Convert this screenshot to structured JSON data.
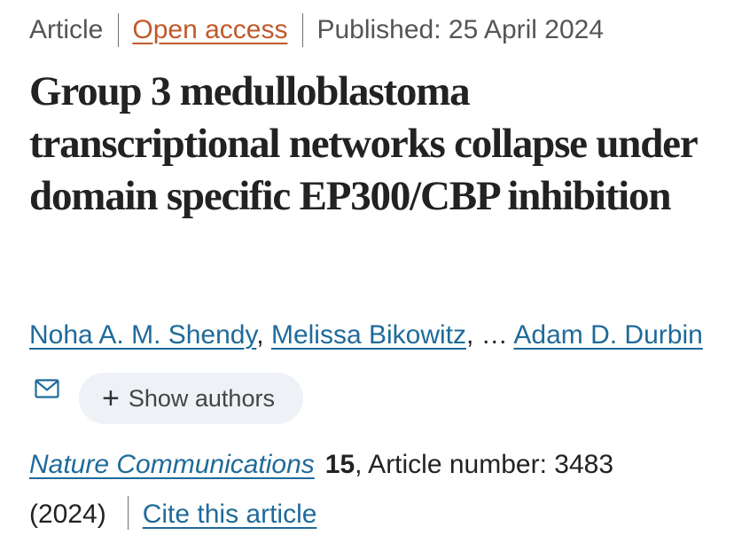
{
  "meta": {
    "article_type": "Article",
    "access": "Open access",
    "published": "Published: 25 April 2024"
  },
  "title": "Group 3 medulloblastoma transcriptional networks collapse under domain specific EP300/CBP inhibition",
  "authors": {
    "list": [
      "Noha A. M. Shendy",
      "Melissa Bikowitz",
      "Adam D. Durbin"
    ],
    "separator": ",",
    "ellipsis": "…",
    "show_authors_label": "Show authors",
    "show_authors_icon": "plus-icon",
    "corresponding_icon": "mail-icon"
  },
  "citation": {
    "journal": "Nature Communications",
    "volume": "15",
    "article_number": ", Article number: 3483",
    "year": "(2024)",
    "cite_label": "Cite this article"
  },
  "colors": {
    "link": "#1f6a9a",
    "open_access": "#c0592b",
    "text": "#222222",
    "meta_text": "#555555",
    "pill_bg": "#eef2f6"
  }
}
